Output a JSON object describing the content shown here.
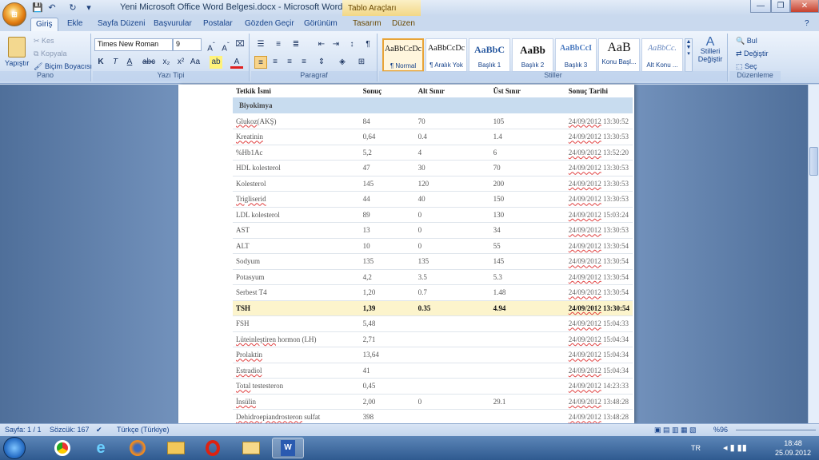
{
  "window": {
    "title": "Yeni Microsoft Office Word Belgesi.docx - Microsoft Word",
    "context_tab": "Tablo Araçları"
  },
  "tabs": [
    "Giriş",
    "Ekle",
    "Sayfa Düzeni",
    "Başvurular",
    "Postalar",
    "Gözden Geçir",
    "Görünüm",
    "Tasarım",
    "Düzen"
  ],
  "clipboard": {
    "paste": "Yapıştır",
    "cut": "Kes",
    "copy": "Kopyala",
    "format_painter": "Biçim Boyacısı",
    "label": "Pano"
  },
  "font": {
    "name": "Times New Roman",
    "size": "9",
    "label": "Yazı Tipi"
  },
  "paragraph": {
    "label": "Paragraf"
  },
  "styles": {
    "items": [
      {
        "sample": "AaBbCcDc",
        "name": "¶ Normal"
      },
      {
        "sample": "AaBbCcDc",
        "name": "¶ Aralık Yok"
      },
      {
        "sample": "AaBbC",
        "name": "Başlık 1"
      },
      {
        "sample": "AaBb",
        "name": "Başlık 2"
      },
      {
        "sample": "AaBbCcI",
        "name": "Başlık 3"
      },
      {
        "sample": "AaB",
        "name": "Konu Başl..."
      },
      {
        "sample": "AaBbCc.",
        "name": "Alt Konu ..."
      }
    ],
    "change": "Stilleri Değiştir",
    "label": "Stiller"
  },
  "editing": {
    "find": "Bul",
    "replace": "Değiştir",
    "select": "Seç",
    "label": "Düzenleme"
  },
  "table": {
    "headers": [
      "Tetkik İsmi",
      "Sonuç",
      "Alt Sınır",
      "Üst Sınır",
      "Sonuç Tarihi"
    ],
    "section": "Biyokimya",
    "rows": [
      [
        "Glukoz(AKŞ)",
        "84",
        "70",
        "105",
        "24/09/2012 13:30:52"
      ],
      [
        "Kreatinin",
        "0,64",
        "0.4",
        "1.4",
        "24/09/2012 13:30:53"
      ],
      [
        "%Hb1Ac",
        "5,2",
        "4",
        "6",
        "24/09/2012 13:52:20"
      ],
      [
        "HDL kolesterol",
        "47",
        "30",
        "70",
        "24/09/2012 13:30:53"
      ],
      [
        "Kolesterol",
        "145",
        "120",
        "200",
        "24/09/2012 13:30:53"
      ],
      [
        "Trigliserid",
        "44",
        "40",
        "150",
        "24/09/2012 13:30:53"
      ],
      [
        "LDL kolesterol",
        "89",
        "0",
        "130",
        "24/09/2012 15:03:24"
      ],
      [
        "AST",
        "13",
        "0",
        "34",
        "24/09/2012 13:30:53"
      ],
      [
        "ALT",
        "10",
        "0",
        "55",
        "24/09/2012 13:30:54"
      ],
      [
        "Sodyum",
        "135",
        "135",
        "145",
        "24/09/2012 13:30:54"
      ],
      [
        "Potasyum",
        "4,2",
        "3.5",
        "5.3",
        "24/09/2012 13:30:54"
      ],
      [
        "Serbest T4",
        "1,20",
        "0.7",
        "1.48",
        "24/09/2012 13:30:54"
      ],
      [
        "TSH",
        "1,39",
        "0.35",
        "4.94",
        "24/09/2012 13:30:54"
      ],
      [
        "FSH",
        "5,48",
        "",
        "",
        "24/09/2012 15:04:33"
      ],
      [
        "Lüteinleştiren hormon (LH)",
        "2,71",
        "",
        "",
        "24/09/2012 15:04:34"
      ],
      [
        "Prolaktin",
        "13,64",
        "",
        "",
        "24/09/2012 15:04:34"
      ],
      [
        "Estradiol",
        "41",
        "",
        "",
        "24/09/2012 15:04:34"
      ],
      [
        "Total testesteron",
        "0,45",
        "",
        "",
        "24/09/2012 14:23:33"
      ],
      [
        "İnsülin",
        "2,00",
        "0",
        "29.1",
        "24/09/2012 13:48:28"
      ],
      [
        "Dehidroepiandrosteron sulfat",
        "398",
        "",
        "",
        "24/09/2012 13:48:28"
      ]
    ]
  },
  "status": {
    "page": "Sayfa: 1 / 1",
    "words": "Sözcük: 167",
    "language": "Türkçe (Türkiye)",
    "zoom": "%96"
  },
  "taskbar": {
    "lang": "TR",
    "time": "18:48",
    "date": "25.09.2012"
  }
}
